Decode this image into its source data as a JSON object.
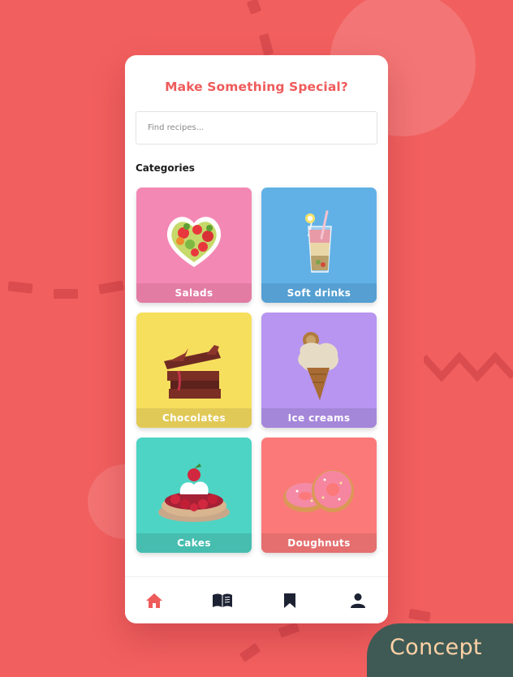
{
  "app": {
    "title": "Make Something Special?"
  },
  "search": {
    "placeholder": "Find recipes...",
    "value": ""
  },
  "categories": {
    "heading": "Categories",
    "items": [
      {
        "label": "Salads",
        "color": "#f388b4",
        "label_bg": "#e27ca3",
        "icon": "salad-bowl-icon"
      },
      {
        "label": "Soft drinks",
        "color": "#62b1e6",
        "label_bg": "#559fd2",
        "icon": "soft-drink-glass-icon"
      },
      {
        "label": "Chocolates",
        "color": "#f7df5e",
        "label_bg": "#e1c957",
        "icon": "chocolate-stack-icon"
      },
      {
        "label": "Ice creams",
        "color": "#b795f0",
        "label_bg": "#a587da",
        "icon": "ice-cream-cone-icon"
      },
      {
        "label": "Cakes",
        "color": "#4dd4c4",
        "label_bg": "#46bdaf",
        "icon": "berry-tart-icon"
      },
      {
        "label": "Doughnuts",
        "color": "#fc7979",
        "label_bg": "#e56f6f",
        "icon": "doughnuts-icon"
      }
    ]
  },
  "nav": {
    "items": [
      {
        "icon": "home-icon",
        "active": true,
        "color": "#ef5b5b"
      },
      {
        "icon": "book-icon",
        "active": false,
        "color": "#1d2233"
      },
      {
        "icon": "bookmark-icon",
        "active": false,
        "color": "#1d2233"
      },
      {
        "icon": "profile-icon",
        "active": false,
        "color": "#1d2233"
      }
    ]
  },
  "badge": {
    "text": "Concept"
  },
  "theme": {
    "background": "#f25f5f",
    "accent": "#ef5b5b"
  }
}
